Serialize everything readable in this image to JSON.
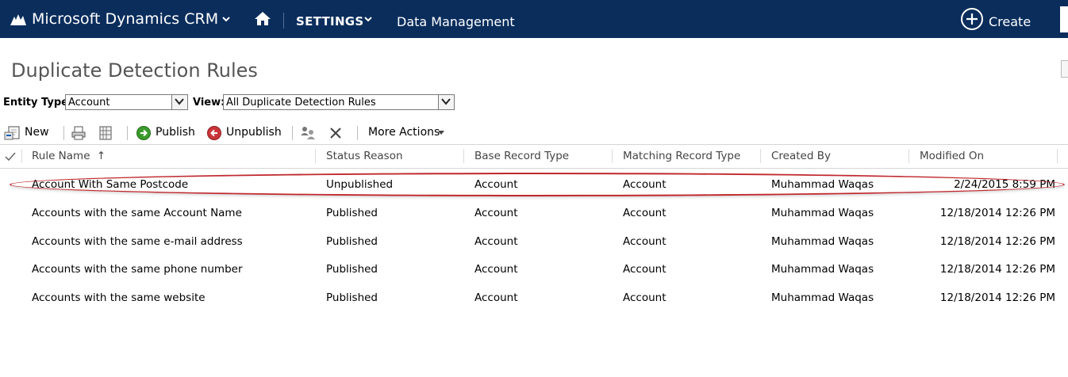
{
  "nav": {
    "app_name": "Microsoft Dynamics CRM",
    "area": "SETTINGS",
    "subarea": "Data Management",
    "create_label": "Create",
    "bar_color": "#0a2d5c"
  },
  "page": {
    "title": "Duplicate Detection Rules"
  },
  "filters": {
    "entity_type_label": "Entity Type:",
    "entity_type_value": "Account",
    "view_label": "View:",
    "view_value": "All Duplicate Detection Rules"
  },
  "toolbar": {
    "new_label": "New",
    "publish_label": "Publish",
    "unpublish_label": "Unpublish",
    "more_actions_label": "More Actions",
    "icons": [
      "new-icon",
      "print-icon",
      "export-icon",
      "publish-icon",
      "unpublish-icon",
      "assign-icon",
      "delete-icon"
    ]
  },
  "grid": {
    "columns": [
      "Rule Name",
      "Status Reason",
      "Base Record Type",
      "Matching Record Type",
      "Created By",
      "Modified On"
    ],
    "sort_indicator": "↑",
    "rows": [
      {
        "rule_name": "Account With Same Postcode",
        "status": "Unpublished",
        "base": "Account",
        "matching": "Account",
        "created_by": "Muhammad Waqas",
        "modified_on": "2/24/2015 8:59 PM",
        "highlighted": true
      },
      {
        "rule_name": "Accounts with the same Account Name",
        "status": "Published",
        "base": "Account",
        "matching": "Account",
        "created_by": "Muhammad Waqas",
        "modified_on": "12/18/2014 12:26 PM"
      },
      {
        "rule_name": "Accounts with the same e-mail address",
        "status": "Published",
        "base": "Account",
        "matching": "Account",
        "created_by": "Muhammad Waqas",
        "modified_on": "12/18/2014 12:26 PM"
      },
      {
        "rule_name": "Accounts with the same phone number",
        "status": "Published",
        "base": "Account",
        "matching": "Account",
        "created_by": "Muhammad Waqas",
        "modified_on": "12/18/2014 12:26 PM"
      },
      {
        "rule_name": "Accounts with the same website",
        "status": "Published",
        "base": "Account",
        "matching": "Account",
        "created_by": "Muhammad Waqas",
        "modified_on": "12/18/2014 12:26 PM"
      }
    ],
    "highlight_color": "#c0282d"
  }
}
